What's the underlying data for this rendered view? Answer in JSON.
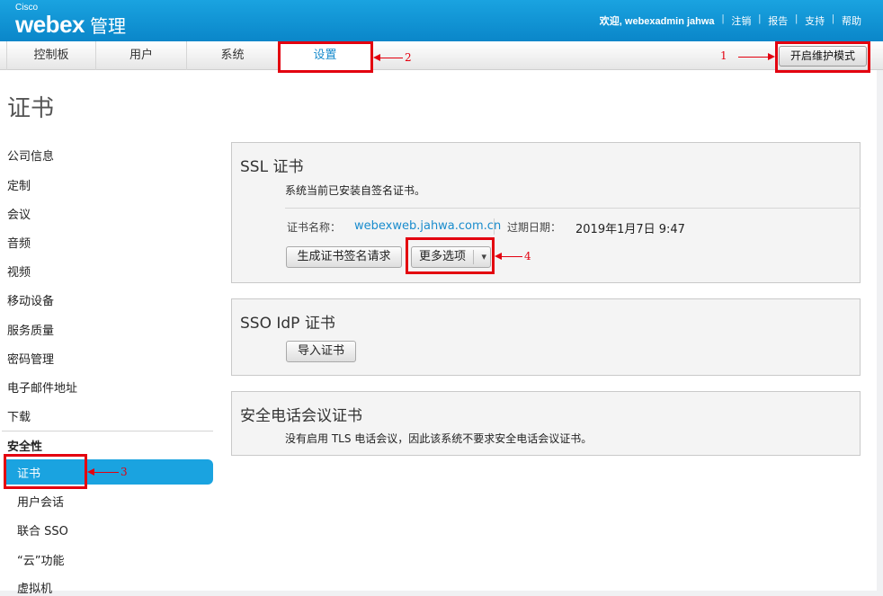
{
  "header": {
    "brand_small": "Cisco",
    "brand_main": "webex",
    "brand_suffix": "管理",
    "welcome": "欢迎, webexadmin jahwa",
    "links": [
      "注销",
      "报告",
      "支持",
      "帮助"
    ]
  },
  "tabs": [
    "控制板",
    "用户",
    "系统",
    "设置"
  ],
  "maintenance_button": "开启维护模式",
  "page_title": "证书",
  "sidebar": {
    "items": [
      "公司信息",
      "定制",
      "会议",
      "音频",
      "视频",
      "移动设备",
      "服务质量",
      "密码管理",
      "电子邮件地址",
      "下载"
    ],
    "section_head": "安全性",
    "sub_items": [
      "证书",
      "用户会话",
      "联合 SSO",
      "“云”功能",
      "虚拟机"
    ]
  },
  "ssl_panel": {
    "title": "SSL 证书",
    "description": "系统当前已安装自签名证书。",
    "cert_name_label": "证书名称：",
    "cert_name_value": "webexweb.jahwa.com.cn",
    "expiry_label": "过期日期：",
    "expiry_value": "2019年1月7日 9:47",
    "generate_csr_button": "生成证书签名请求",
    "more_options_button": "更多选项",
    "dropdown_glyph": "▾"
  },
  "sso_panel": {
    "title": "SSO IdP 证书",
    "import_button": "导入证书"
  },
  "secure_conf_panel": {
    "title": "安全电话会议证书",
    "description": "没有启用 TLS 电话会议，因此该系统不要求安全电话会议证书。"
  },
  "annotations": [
    "1",
    "2",
    "3",
    "4"
  ],
  "colors": {
    "header_blue": "#0a86c9",
    "active_blue": "#1aa3e0",
    "link_blue": "#1a8ccd",
    "annotation_red": "#e3000f"
  }
}
